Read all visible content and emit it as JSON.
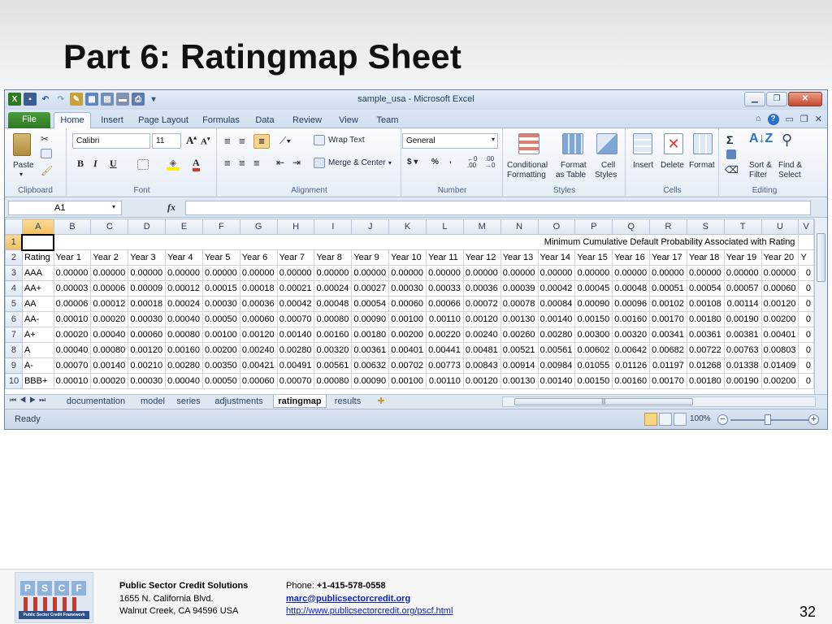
{
  "slide": {
    "title": "Part 6: Ratingmap Sheet",
    "page_number": "32"
  },
  "window": {
    "title": "sample_usa  -  Microsoft Excel"
  },
  "ribbon_tabs": [
    "File",
    "Home",
    "Insert",
    "Page Layout",
    "Formulas",
    "Data",
    "Review",
    "View",
    "Team"
  ],
  "ribbon": {
    "clipboard": {
      "label": "Clipboard",
      "paste": "Paste"
    },
    "font": {
      "label": "Font",
      "name": "Calibri",
      "size": "11"
    },
    "alignment": {
      "label": "Alignment",
      "wrap_text": "Wrap Text",
      "merge_center": "Merge & Center"
    },
    "number": {
      "label": "Number",
      "format": "General"
    },
    "styles": {
      "label": "Styles",
      "conditional": "Conditional",
      "conditional2": "Formatting",
      "format_as": "Format",
      "format_as2": "as Table",
      "cell": "Cell",
      "cell2": "Styles"
    },
    "cells": {
      "label": "Cells",
      "insert": "Insert",
      "delete": "Delete",
      "format": "Format"
    },
    "editing": {
      "label": "Editing",
      "sort": "Sort &",
      "sort2": "Filter",
      "find": "Find &",
      "find2": "Select"
    }
  },
  "formula_bar": {
    "name_box": "A1",
    "fx": "fx",
    "formula": ""
  },
  "sheet": {
    "columns": [
      "A",
      "B",
      "C",
      "D",
      "E",
      "F",
      "G",
      "H",
      "I",
      "J",
      "K",
      "L",
      "M",
      "N",
      "O",
      "P",
      "Q",
      "R",
      "S",
      "T",
      "U",
      "V"
    ],
    "row_numbers": [
      "1",
      "2",
      "3",
      "4",
      "5",
      "6",
      "7",
      "8",
      "9",
      "10"
    ],
    "row1_title": "Minimum Cumulative Default Probability Associated with Rating",
    "header_row": [
      "Rating",
      "Year 1",
      "Year 2",
      "Year 3",
      "Year 4",
      "Year 5",
      "Year 6",
      "Year 7",
      "Year 8",
      "Year 9",
      "Year 10",
      "Year 11",
      "Year 12",
      "Year 13",
      "Year 14",
      "Year 15",
      "Year 16",
      "Year 17",
      "Year 18",
      "Year 19",
      "Year 20",
      "Y"
    ],
    "rows": [
      [
        "AAA",
        "0.00000",
        "0.00000",
        "0.00000",
        "0.00000",
        "0.00000",
        "0.00000",
        "0.00000",
        "0.00000",
        "0.00000",
        "0.00000",
        "0.00000",
        "0.00000",
        "0.00000",
        "0.00000",
        "0.00000",
        "0.00000",
        "0.00000",
        "0.00000",
        "0.00000",
        "0.00000",
        "0"
      ],
      [
        "AA+",
        "0.00003",
        "0.00006",
        "0.00009",
        "0.00012",
        "0.00015",
        "0.00018",
        "0.00021",
        "0.00024",
        "0.00027",
        "0.00030",
        "0.00033",
        "0.00036",
        "0.00039",
        "0.00042",
        "0.00045",
        "0.00048",
        "0.00051",
        "0.00054",
        "0.00057",
        "0.00060",
        "0"
      ],
      [
        "AA",
        "0.00006",
        "0.00012",
        "0.00018",
        "0.00024",
        "0.00030",
        "0.00036",
        "0.00042",
        "0.00048",
        "0.00054",
        "0.00060",
        "0.00066",
        "0.00072",
        "0.00078",
        "0.00084",
        "0.00090",
        "0.00096",
        "0.00102",
        "0.00108",
        "0.00114",
        "0.00120",
        "0"
      ],
      [
        "AA-",
        "0.00010",
        "0.00020",
        "0.00030",
        "0.00040",
        "0.00050",
        "0.00060",
        "0.00070",
        "0.00080",
        "0.00090",
        "0.00100",
        "0.00110",
        "0.00120",
        "0.00130",
        "0.00140",
        "0.00150",
        "0.00160",
        "0.00170",
        "0.00180",
        "0.00190",
        "0.00200",
        "0"
      ],
      [
        "A+",
        "0.00020",
        "0.00040",
        "0.00060",
        "0.00080",
        "0.00100",
        "0.00120",
        "0.00140",
        "0.00160",
        "0.00180",
        "0.00200",
        "0.00220",
        "0.00240",
        "0.00260",
        "0.00280",
        "0.00300",
        "0.00320",
        "0.00341",
        "0.00361",
        "0.00381",
        "0.00401",
        "0"
      ],
      [
        "A",
        "0.00040",
        "0.00080",
        "0.00120",
        "0.00160",
        "0.00200",
        "0.00240",
        "0.00280",
        "0.00320",
        "0.00361",
        "0.00401",
        "0.00441",
        "0.00481",
        "0.00521",
        "0.00561",
        "0.00602",
        "0.00642",
        "0.00682",
        "0.00722",
        "0.00763",
        "0.00803",
        "0"
      ],
      [
        "A-",
        "0.00070",
        "0.00140",
        "0.00210",
        "0.00280",
        "0.00350",
        "0.00421",
        "0.00491",
        "0.00561",
        "0.00632",
        "0.00702",
        "0.00773",
        "0.00843",
        "0.00914",
        "0.00984",
        "0.01055",
        "0.01126",
        "0.01197",
        "0.01268",
        "0.01338",
        "0.01409",
        "0"
      ],
      [
        "BBB+",
        "0.00010",
        "0.00020",
        "0.00030",
        "0.00040",
        "0.00050",
        "0.00060",
        "0.00070",
        "0.00080",
        "0.00090",
        "0.00100",
        "0.00110",
        "0.00120",
        "0.00130",
        "0.00140",
        "0.00150",
        "0.00160",
        "0.00170",
        "0.00180",
        "0.00190",
        "0.00200",
        "0"
      ]
    ]
  },
  "sheet_tabs": [
    "documentation",
    "model",
    "series",
    "adjustments",
    "ratingmap",
    "results"
  ],
  "active_sheet": "ratingmap",
  "status": {
    "ready": "Ready",
    "zoom": "100%"
  },
  "footer": {
    "org": "Public Sector Credit Solutions",
    "address1": "1655 N. California Blvd.",
    "address2": "Walnut Creek, CA 94596  USA",
    "phone_label": "Phone: ",
    "phone": "+1-415-578-0558",
    "email": "marc@publicsectorcredit.org",
    "url": "http://www.publicsectorcredit.org/pscf.html",
    "logo_letters": [
      "P",
      "S",
      "C",
      "F"
    ],
    "logo_band": "Public Sector Credit Framework"
  },
  "colors": {
    "excel_green": "#2c7a22",
    "link": "#0b20c9",
    "selected_header": "#f1c15f"
  }
}
